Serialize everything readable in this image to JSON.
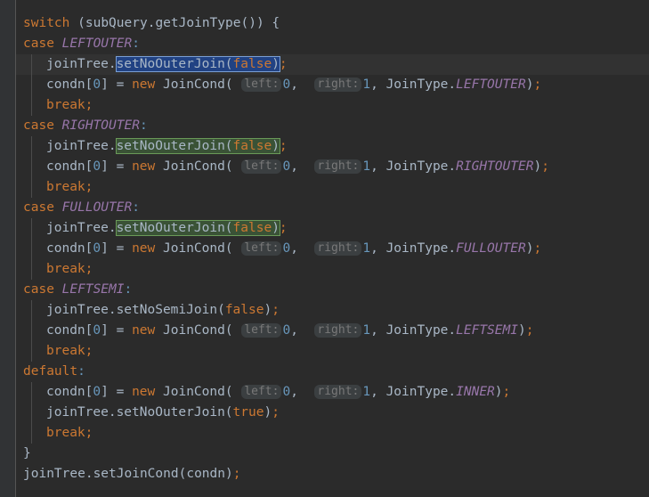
{
  "editor": {
    "theme": "darcula",
    "background": "#2b2b2b",
    "gutter_background": "#313335",
    "caret_line_background": "#323232",
    "default_text_color": "#a9b7c6",
    "keyword_color": "#cc7832",
    "number_color": "#6897bb",
    "constant_color": "#9876aa",
    "hint_background": "#3b3f41",
    "hint_text_color": "#787878",
    "selection_background": "#214283",
    "selection_border": "#7a9fd4",
    "occurrence_background": "#3a5236",
    "occurrence_border": "#6a9a58",
    "line_height": 23,
    "caret_line_index": 2
  },
  "code": {
    "language": "java",
    "lines": [
      {
        "indent": 0,
        "text": "switch (subQuery.getJoinType()) {"
      },
      {
        "indent": 0,
        "text": "case LEFTOUTER:"
      },
      {
        "indent": 1,
        "text": "joinTree.setNoOuterJoin(false);"
      },
      {
        "indent": 1,
        "text": "condn[0] = new JoinCond( left: 0,  right: 1, JoinType.LEFTOUTER);"
      },
      {
        "indent": 1,
        "text": "break;"
      },
      {
        "indent": 0,
        "text": "case RIGHTOUTER:"
      },
      {
        "indent": 1,
        "text": "joinTree.setNoOuterJoin(false);"
      },
      {
        "indent": 1,
        "text": "condn[0] = new JoinCond( left: 0,  right: 1, JoinType.RIGHTOUTER);"
      },
      {
        "indent": 1,
        "text": "break;"
      },
      {
        "indent": 0,
        "text": "case FULLOUTER:"
      },
      {
        "indent": 1,
        "text": "joinTree.setNoOuterJoin(false);"
      },
      {
        "indent": 1,
        "text": "condn[0] = new JoinCond( left: 0,  right: 1, JoinType.FULLOUTER);"
      },
      {
        "indent": 1,
        "text": "break;"
      },
      {
        "indent": 0,
        "text": "case LEFTSEMI:"
      },
      {
        "indent": 1,
        "text": "joinTree.setNoSemiJoin(false);"
      },
      {
        "indent": 1,
        "text": "condn[0] = new JoinCond( left: 0,  right: 1, JoinType.LEFTSEMI);"
      },
      {
        "indent": 1,
        "text": "break;"
      },
      {
        "indent": 0,
        "text": "default:"
      },
      {
        "indent": 1,
        "text": "condn[0] = new JoinCond( left: 0,  right: 1, JoinType.INNER);"
      },
      {
        "indent": 1,
        "text": "joinTree.setNoOuterJoin(true);"
      },
      {
        "indent": 1,
        "text": "break;"
      },
      {
        "indent": 0,
        "text": "}"
      },
      {
        "indent": 0,
        "text": "joinTree.setJoinCond(condn);"
      }
    ]
  },
  "tokens": {
    "kw_switch": "switch",
    "kw_case": "case",
    "kw_new": "new",
    "kw_break": "break",
    "kw_default": "default",
    "kw_false": "false",
    "kw_true": "true",
    "obj_joinTree": "joinTree",
    "obj_subQuery": "subQuery",
    "obj_condn": "condn",
    "call_getJoinType": "getJoinType",
    "call_setNoOuterJoin": "setNoOuterJoin",
    "call_setNoSemiJoin": "setNoSemiJoin",
    "call_setJoinCond": "setJoinCond",
    "type_JoinCond": "JoinCond",
    "type_JoinType": "JoinType",
    "const_LEFTOUTER": "LEFTOUTER",
    "const_RIGHTOUTER": "RIGHTOUTER",
    "const_FULLOUTER": "FULLOUTER",
    "const_LEFTSEMI": "LEFTSEMI",
    "const_INNER": "INNER",
    "num_zero": "0",
    "num_one": "1",
    "hint_left": "left:",
    "hint_right": "right:",
    "paren_open": "(",
    "paren_close": ")",
    "brace_open": "{",
    "brace_close": "}",
    "bracket_open": "[",
    "bracket_close": "]",
    "semicolon": ";",
    "colon": ":",
    "comma": ",",
    "dot": ".",
    "equals": "=",
    "space": " ",
    "call_open_space": "( ",
    "arg_sep": ",  "
  }
}
